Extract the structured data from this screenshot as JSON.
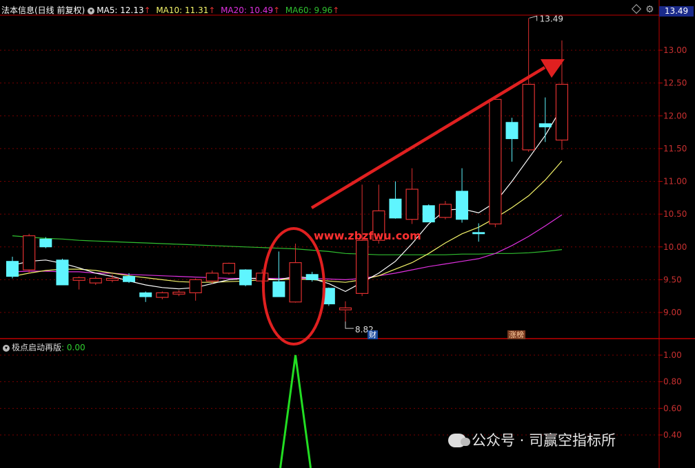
{
  "header": {
    "stock": "法本信息(日线 前复权)",
    "ma5": "MA5: 12.13",
    "ma10": "MA10: 11.31",
    "ma20": "MA20: 10.49",
    "ma60": "MA60: 9.96",
    "up_arrow": "↑",
    "current_price": "13.49"
  },
  "sub_header": {
    "name": "极点启动再版",
    "value": ": 0.00"
  },
  "watermark": "公众号 · 司赢空指标所",
  "site_watermark": "www.zbzfwu.com",
  "badges": {
    "cai": "财",
    "zhangting": "涨榜"
  },
  "colors": {
    "up": "#e03030",
    "down": "#5ff5ff",
    "ma5": "#ffffff",
    "ma10": "#f4f46a",
    "ma20": "#e030e0",
    "ma60": "#30c030",
    "signal": "#22dd22",
    "axis": "#c00000",
    "annotation": "#e02020"
  },
  "chart_data": [
    {
      "type": "candlestick",
      "y_axis_ticks": [
        "13.00",
        "12.50",
        "12.00",
        "11.50",
        "11.00",
        "10.50",
        "10.00",
        "9.50",
        "9.00"
      ],
      "y_axis_values": [
        13.0,
        12.5,
        12.0,
        11.5,
        11.0,
        10.5,
        10.0,
        9.5,
        9.0
      ],
      "ylim": [
        8.6,
        13.7
      ],
      "high_label": "13.49",
      "low_label": "8.82",
      "candles": [
        {
          "o": 9.78,
          "h": 9.85,
          "l": 9.52,
          "c": 9.55
        },
        {
          "o": 9.65,
          "h": 10.2,
          "l": 9.6,
          "c": 10.17
        },
        {
          "o": 10.12,
          "h": 10.15,
          "l": 9.98,
          "c": 10.0
        },
        {
          "o": 9.8,
          "h": 9.82,
          "l": 9.42,
          "c": 9.42
        },
        {
          "o": 9.49,
          "h": 9.55,
          "l": 9.35,
          "c": 9.53
        },
        {
          "o": 9.45,
          "h": 9.55,
          "l": 9.42,
          "c": 9.52
        },
        {
          "o": 9.49,
          "h": 9.58,
          "l": 9.46,
          "c": 9.52
        },
        {
          "o": 9.55,
          "h": 9.6,
          "l": 9.45,
          "c": 9.47
        },
        {
          "o": 9.3,
          "h": 9.32,
          "l": 9.16,
          "c": 9.24
        },
        {
          "o": 9.23,
          "h": 9.32,
          "l": 9.2,
          "c": 9.3
        },
        {
          "o": 9.28,
          "h": 9.34,
          "l": 9.25,
          "c": 9.31
        },
        {
          "o": 9.3,
          "h": 9.52,
          "l": 9.18,
          "c": 9.5
        },
        {
          "o": 9.48,
          "h": 9.64,
          "l": 9.44,
          "c": 9.6
        },
        {
          "o": 9.6,
          "h": 9.76,
          "l": 9.58,
          "c": 9.75
        },
        {
          "o": 9.65,
          "h": 9.66,
          "l": 9.4,
          "c": 9.42
        },
        {
          "o": 9.48,
          "h": 9.66,
          "l": 9.44,
          "c": 9.6
        },
        {
          "o": 9.47,
          "h": 9.93,
          "l": 9.24,
          "c": 9.24
        },
        {
          "o": 9.16,
          "h": 10.05,
          "l": 9.15,
          "c": 9.76
        },
        {
          "o": 9.58,
          "h": 9.62,
          "l": 9.47,
          "c": 9.5
        },
        {
          "o": 9.37,
          "h": 9.38,
          "l": 9.1,
          "c": 9.13
        },
        {
          "o": 9.04,
          "h": 9.17,
          "l": 8.82,
          "c": 9.07
        },
        {
          "o": 9.29,
          "h": 10.95,
          "l": 9.25,
          "c": 10.1
        },
        {
          "o": 10.1,
          "h": 10.95,
          "l": 10.05,
          "c": 10.55
        },
        {
          "o": 10.73,
          "h": 11.0,
          "l": 10.43,
          "c": 10.44
        },
        {
          "o": 10.42,
          "h": 11.2,
          "l": 10.35,
          "c": 10.88
        },
        {
          "o": 10.63,
          "h": 10.65,
          "l": 10.38,
          "c": 10.38
        },
        {
          "o": 10.45,
          "h": 10.7,
          "l": 10.42,
          "c": 10.65
        },
        {
          "o": 10.85,
          "h": 11.2,
          "l": 10.37,
          "c": 10.42
        },
        {
          "o": 10.22,
          "h": 10.36,
          "l": 10.08,
          "c": 10.2
        },
        {
          "o": 10.35,
          "h": 12.25,
          "l": 10.3,
          "c": 12.25
        },
        {
          "o": 11.9,
          "h": 11.97,
          "l": 11.3,
          "c": 11.65
        },
        {
          "o": 11.48,
          "h": 13.49,
          "l": 11.45,
          "c": 12.48
        },
        {
          "o": 11.88,
          "h": 12.28,
          "l": 11.6,
          "c": 11.83
        },
        {
          "o": 11.63,
          "h": 13.15,
          "l": 11.48,
          "c": 12.48
        }
      ],
      "ma5": [
        9.72,
        9.78,
        9.8,
        9.75,
        9.68,
        9.6,
        9.55,
        9.48,
        9.42,
        9.38,
        9.36,
        9.38,
        9.44,
        9.5,
        9.52,
        9.52,
        9.5,
        9.55,
        9.52,
        9.44,
        9.32,
        9.46,
        9.6,
        9.78,
        10.05,
        10.35,
        10.56,
        10.58,
        10.52,
        10.68,
        11.0,
        11.35,
        11.7,
        12.13
      ],
      "ma10": [
        9.55,
        9.6,
        9.64,
        9.66,
        9.66,
        9.64,
        9.6,
        9.56,
        9.53,
        9.5,
        9.47,
        9.46,
        9.46,
        9.47,
        9.48,
        9.5,
        9.5,
        9.51,
        9.5,
        9.48,
        9.46,
        9.5,
        9.56,
        9.66,
        9.76,
        9.9,
        10.06,
        10.2,
        10.3,
        10.44,
        10.6,
        10.78,
        11.02,
        11.31
      ],
      "ma20": [
        9.62,
        9.63,
        9.63,
        9.62,
        9.62,
        9.6,
        9.6,
        9.58,
        9.57,
        9.56,
        9.55,
        9.54,
        9.53,
        9.52,
        9.52,
        9.52,
        9.52,
        9.52,
        9.52,
        9.51,
        9.5,
        9.52,
        9.56,
        9.6,
        9.65,
        9.7,
        9.74,
        9.78,
        9.82,
        9.9,
        10.02,
        10.16,
        10.32,
        10.49
      ],
      "ma60": [
        10.17,
        10.15,
        10.13,
        10.12,
        10.1,
        10.09,
        10.08,
        10.07,
        10.06,
        10.05,
        10.04,
        10.03,
        10.02,
        10.01,
        10.0,
        9.99,
        9.98,
        9.97,
        9.95,
        9.93,
        9.9,
        9.89,
        9.88,
        9.88,
        9.88,
        9.88,
        9.88,
        9.89,
        9.89,
        9.9,
        9.9,
        9.91,
        9.93,
        9.96
      ]
    },
    {
      "type": "line",
      "title": "极点启动再版",
      "y_axis_ticks": [
        "1.00",
        "0.80",
        "0.60",
        "0.40"
      ],
      "y_axis_values": [
        1.0,
        0.8,
        0.6,
        0.4
      ],
      "ylim": [
        0.0,
        1.1
      ],
      "values": [
        0,
        0,
        0,
        0,
        0,
        0,
        0,
        0,
        0,
        0,
        0,
        0,
        0,
        0,
        0,
        0,
        0,
        1,
        0,
        0,
        0,
        0,
        0,
        0,
        0,
        0,
        0,
        0,
        0,
        0,
        0,
        0,
        0,
        0
      ]
    }
  ]
}
